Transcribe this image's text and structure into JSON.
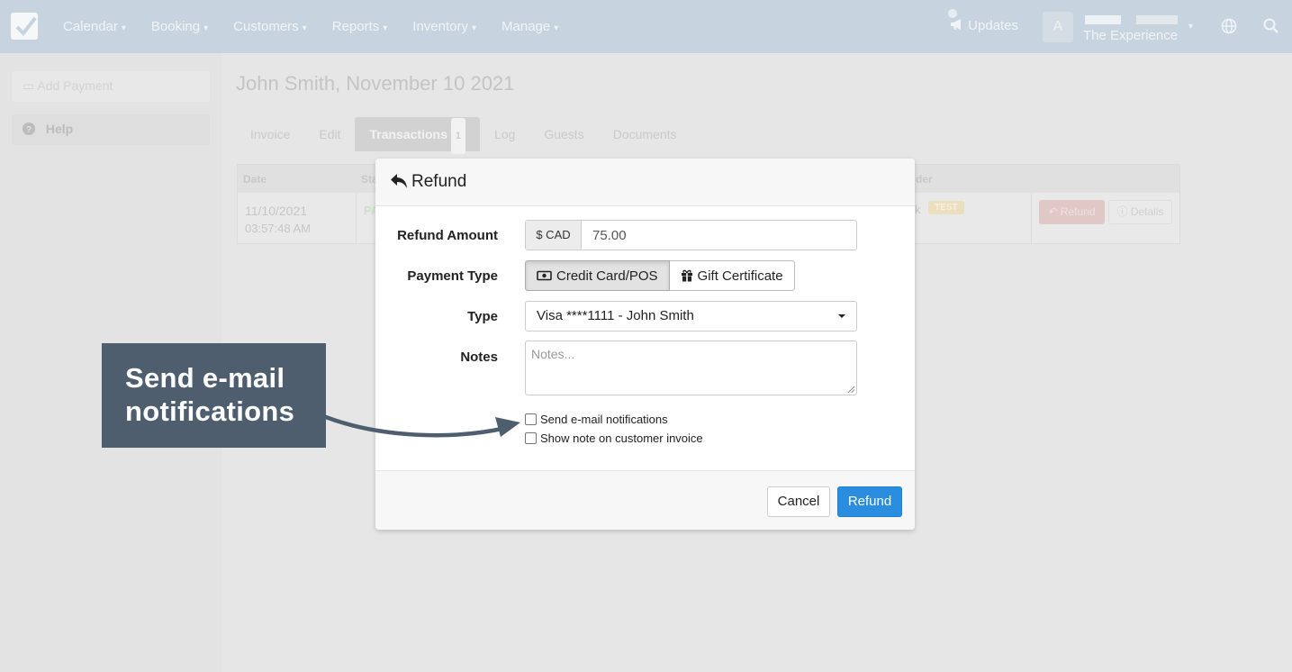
{
  "navbar": {
    "menu": [
      {
        "label": "Calendar"
      },
      {
        "label": "Booking"
      },
      {
        "label": "Customers"
      },
      {
        "label": "Reports"
      },
      {
        "label": "Inventory"
      },
      {
        "label": "Manage"
      }
    ],
    "updates_label": "Updates",
    "avatar_initial": "A",
    "account_label": "The Experience"
  },
  "sidebar": {
    "add_payment_label": "Add Payment",
    "help_label": "Help"
  },
  "page": {
    "title": "John Smith, November 10 2021",
    "tabs": [
      {
        "label": "Invoice"
      },
      {
        "label": "Edit"
      },
      {
        "label": "Transactions",
        "badge": "1"
      },
      {
        "label": "Log"
      },
      {
        "label": "Guests"
      },
      {
        "label": "Documents"
      }
    ]
  },
  "transactions_table": {
    "headers": {
      "date": "Date",
      "status": "Sta",
      "provider": "der"
    },
    "row": {
      "date": "11/10/2021",
      "time": "03:57:48 AM",
      "status": "PA",
      "provider_fragment": "k",
      "test_badge": "TEST",
      "refund_label": "Refund",
      "details_label": "Details"
    }
  },
  "modal": {
    "title": "Refund",
    "refund_amount_label": "Refund Amount",
    "currency": "$ CAD",
    "amount": "75.00",
    "payment_type_label": "Payment Type",
    "payment_types": [
      {
        "label": "Credit Card/POS",
        "selected": true
      },
      {
        "label": "Gift Certificate",
        "selected": false
      }
    ],
    "type_label": "Type",
    "type_value": "Visa ****1111 - John Smith",
    "notes_label": "Notes",
    "notes_placeholder": "Notes...",
    "send_email_label": "Send e-mail notifications",
    "send_email_checked": false,
    "show_note_label": "Show note on customer invoice",
    "show_note_checked": false,
    "cancel_label": "Cancel",
    "refund_label": "Refund",
    "primary_color": "#2a8de0"
  },
  "callout": {
    "line1": "Send e-mail",
    "line2": "notifications",
    "color": "#4e5e6e"
  }
}
